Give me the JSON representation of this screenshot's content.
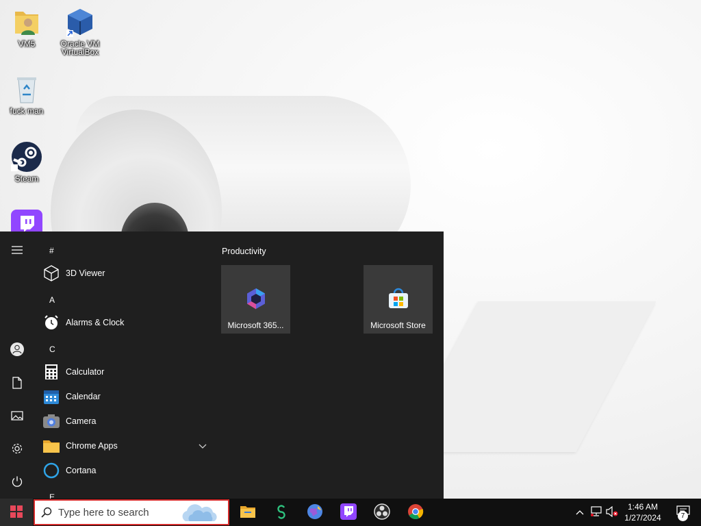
{
  "desktop": {
    "icons": [
      {
        "label": "VM5",
        "icon": "folder-user-icon"
      },
      {
        "label": "Oracle VM VirtualBox",
        "icon": "virtualbox-icon"
      },
      {
        "label": "fuck man",
        "icon": "recycle-bin-icon"
      },
      {
        "label": "Steam",
        "icon": "steam-icon"
      },
      {
        "label": "",
        "icon": "twitch-icon"
      }
    ]
  },
  "start_menu": {
    "rail": [
      "hamburger-icon",
      "user-icon",
      "documents-icon",
      "pictures-icon",
      "settings-icon",
      "power-icon"
    ],
    "letters": {
      "hash": "#",
      "a": "A",
      "c": "C",
      "e": "E"
    },
    "apps": [
      {
        "name": "3D Viewer",
        "icon": "cube-icon"
      },
      {
        "name": "Alarms & Clock",
        "icon": "alarm-clock-icon"
      },
      {
        "name": "Calculator",
        "icon": "calculator-icon"
      },
      {
        "name": "Calendar",
        "icon": "calendar-icon"
      },
      {
        "name": "Camera",
        "icon": "camera-icon"
      },
      {
        "name": "Chrome Apps",
        "icon": "folder-icon"
      },
      {
        "name": "Cortana",
        "icon": "cortana-icon"
      }
    ],
    "group_title": "Productivity",
    "tiles": [
      {
        "label": "Microsoft 365...",
        "icon": "microsoft-365-icon"
      },
      {
        "label": "Microsoft Store",
        "icon": "microsoft-store-icon"
      }
    ]
  },
  "taskbar": {
    "search_placeholder": "Type here to search",
    "apps": [
      "file-explorer-icon",
      "app-s-icon",
      "globe-icon",
      "twitch-icon",
      "obs-icon",
      "chrome-icon"
    ],
    "tray": [
      "chevron-up-icon",
      "network-icon",
      "volume-muted-icon"
    ],
    "time": "1:46 AM",
    "date": "1/27/2024",
    "notification_count": "7"
  },
  "colors": {
    "start_bg": "#1f1f1f",
    "tile_bg": "#3a3a3a",
    "taskbar_bg": "#101010",
    "search_border": "#d62b2b"
  }
}
